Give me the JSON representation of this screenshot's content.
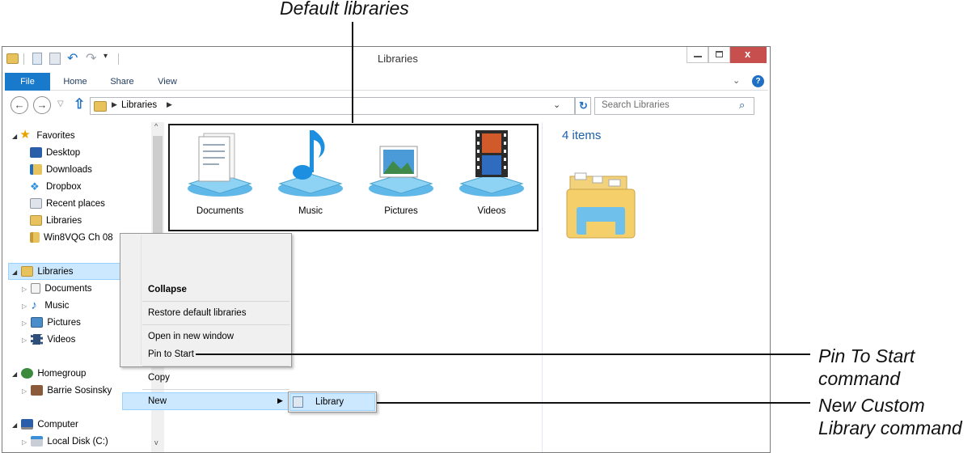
{
  "callouts": {
    "default_libraries": "Default libraries",
    "pin_line1": "Pin To Start",
    "pin_line2": "command",
    "new_line1": "New Custom",
    "new_line2": "Library command"
  },
  "window": {
    "title": "Libraries",
    "ribbon_tabs": [
      "File",
      "Home",
      "Share",
      "View"
    ],
    "address_crumb": "Libraries",
    "search_placeholder": "Search Libraries",
    "item_count": "4 items"
  },
  "nav": {
    "favorites": {
      "label": "Favorites",
      "items": [
        "Desktop",
        "Downloads",
        "Dropbox",
        "Recent places",
        "Libraries",
        "Win8VQG Ch 08"
      ]
    },
    "libraries": {
      "label": "Libraries",
      "items": [
        "Documents",
        "Music",
        "Pictures",
        "Videos"
      ]
    },
    "homegroup": {
      "label": "Homegroup",
      "items": [
        "Barrie Sosinsky"
      ]
    },
    "computer": {
      "label": "Computer",
      "items": [
        "Local Disk (C:)"
      ]
    }
  },
  "libraries": [
    "Documents",
    "Music",
    "Pictures",
    "Videos"
  ],
  "context_menu": {
    "collapse": "Collapse",
    "restore": "Restore default libraries",
    "open_new": "Open in new window",
    "pin": "Pin to Start",
    "copy": "Copy",
    "new": "New"
  },
  "submenu": {
    "library": "Library"
  },
  "colors": {
    "file_tab": "#1979ca",
    "highlight": "#cce8ff",
    "count_text": "#1e5fa8"
  }
}
